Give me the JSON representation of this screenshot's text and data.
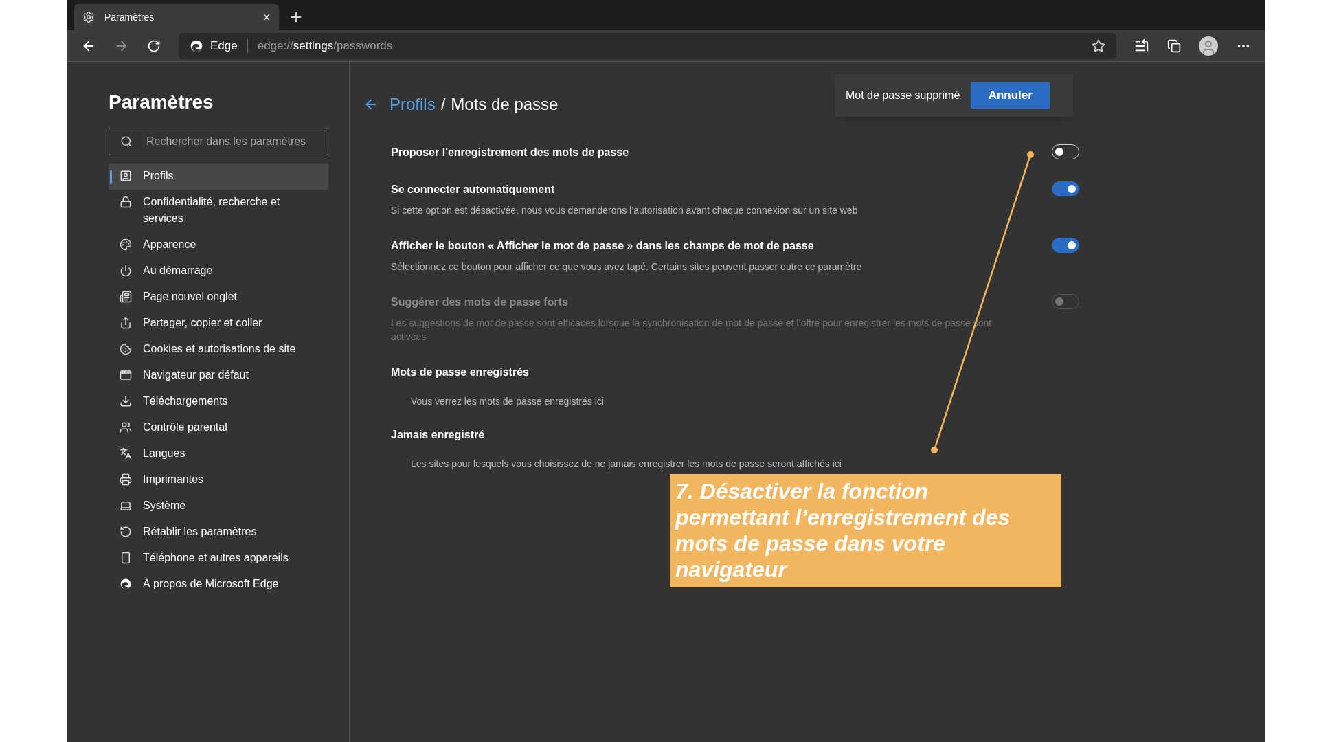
{
  "tab": {
    "title": "Paramètres",
    "close": "×"
  },
  "address_bar": {
    "site": "Edge",
    "url_prefix": "edge://",
    "url_bold": "settings",
    "url_suffix": "/passwords"
  },
  "sidebar": {
    "title": "Paramètres",
    "search": {
      "placeholder": "Rechercher dans les paramètres"
    },
    "items": [
      {
        "label": "Profils",
        "selected": true
      },
      {
        "label": "Confidentialité, recherche et services",
        "selected": false
      },
      {
        "label": "Apparence",
        "selected": false
      },
      {
        "label": "Au démarrage",
        "selected": false
      },
      {
        "label": "Page nouvel onglet",
        "selected": false
      },
      {
        "label": "Partager, copier et coller",
        "selected": false
      },
      {
        "label": "Cookies et autorisations de site",
        "selected": false
      },
      {
        "label": "Navigateur par défaut",
        "selected": false
      },
      {
        "label": "Téléchargements",
        "selected": false
      },
      {
        "label": "Contrôle parental",
        "selected": false
      },
      {
        "label": "Langues",
        "selected": false
      },
      {
        "label": "Imprimantes",
        "selected": false
      },
      {
        "label": "Système",
        "selected": false
      },
      {
        "label": "Rétablir les paramètres",
        "selected": false
      },
      {
        "label": "Téléphone et autres appareils",
        "selected": false
      },
      {
        "label": "À propos de Microsoft Edge",
        "selected": false
      }
    ]
  },
  "breadcrumb": {
    "parent": "Profils",
    "separator": "/",
    "current": "Mots de passe"
  },
  "toast": {
    "message": "Mot de passe supprimé",
    "button": "Annuler"
  },
  "settings": [
    {
      "title": "Proposer l'enregistrement des mots de passe",
      "on": false,
      "disabled": false
    },
    {
      "title": "Se connecter automatiquement",
      "description": "Si cette option est désactivée, nous vous demanderons l’autorisation avant chaque connexion sur un site web",
      "on": true,
      "disabled": false
    },
    {
      "title": "Afficher le bouton « Afficher le mot de passe » dans les champs de mot de passe",
      "description": "Sélectionnez ce bouton pour afficher ce que vous avez tapé. Certains sites peuvent passer outre ce paramètre",
      "on": true,
      "disabled": false
    },
    {
      "title": "Suggérer des mots de passe forts",
      "description": "Les suggestions de mot de passe sont efficaces lorsque la synchronisation de mot de passe et l’offre pour enregistrer les mots de passe sont activées",
      "on": false,
      "disabled": true
    }
  ],
  "sections": [
    {
      "title": "Mots de passe enregistrés",
      "empty_text": "Vous verrez les mots de passe enregistrés ici"
    },
    {
      "title": "Jamais enregistré",
      "empty_text": "Les sites pour lesquels vous choisissez de ne jamais enregistrer les mots de passe seront affichés ici"
    }
  ],
  "annotation": {
    "text": "7. Désactiver la fonction permettant l’enregistrement des mots de passe dans votre navigateur"
  }
}
